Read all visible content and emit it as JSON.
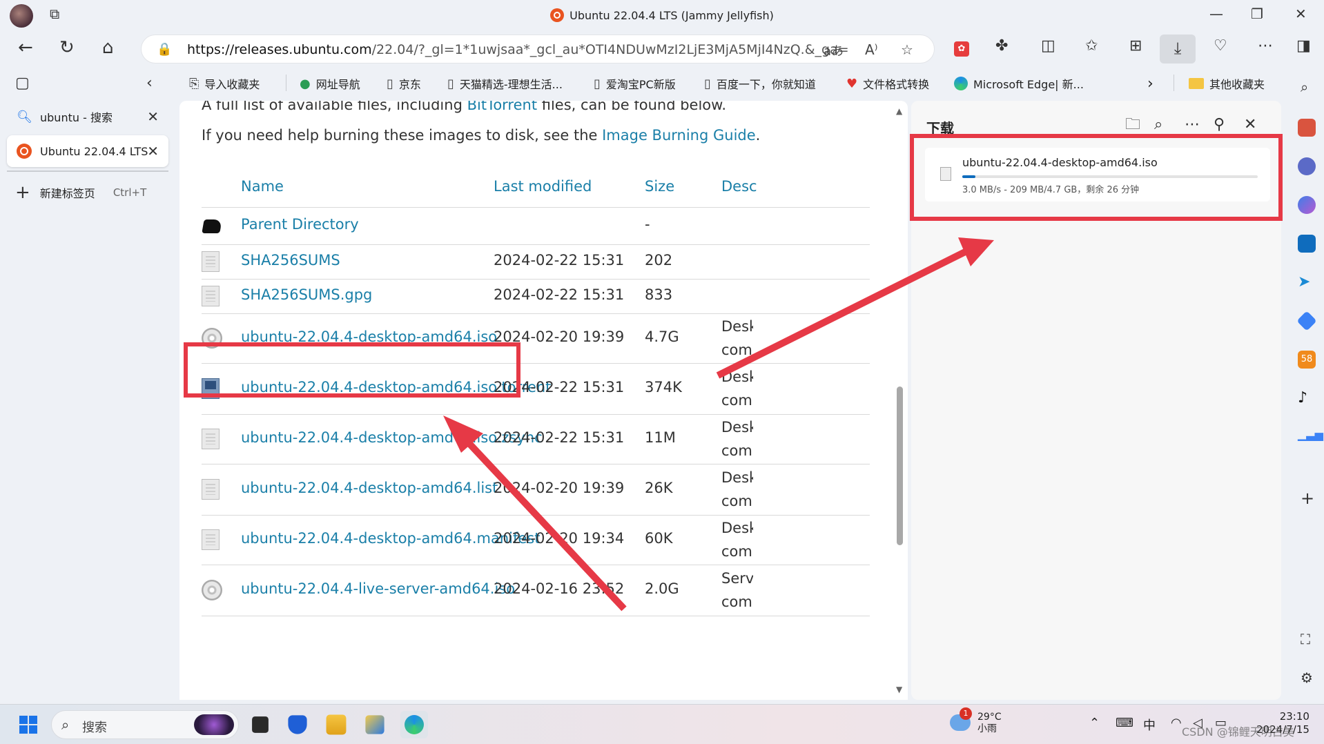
{
  "window": {
    "title": "Ubuntu 22.04.4 LTS (Jammy Jellyfish)"
  },
  "address_bar": {
    "url_host": "https://releases.ubuntu.com",
    "url_rest": "/22.04/?_gl=1*1uwjsaa*_gcl_au*OTI4NDUwMzI2LjE3MjA5MjI4NzQ.&_ga=2....",
    "read_aloud_icon": "aあ"
  },
  "favorites": [
    {
      "label": "导入收藏夹",
      "icon": "import-icon"
    },
    {
      "label": "网址导航",
      "icon": "globe-icon"
    },
    {
      "label": "京东",
      "icon": "page-icon"
    },
    {
      "label": "天猫精选-理想生活...",
      "icon": "page-icon"
    },
    {
      "label": "爱淘宝PC新版",
      "icon": "page-icon"
    },
    {
      "label": "百度一下，你就知道",
      "icon": "page-icon"
    },
    {
      "label": "文件格式转换",
      "icon": "heart-icon"
    },
    {
      "label": "Microsoft Edge| 新...",
      "icon": "edge-icon"
    }
  ],
  "other_favorites": "其他收藏夹",
  "tabs": [
    {
      "label": "ubuntu - 搜索",
      "active": false
    },
    {
      "label": "Ubuntu 22.04.4 LTS",
      "active": true
    }
  ],
  "new_tab": {
    "label": "新建标签页",
    "shortcut": "Ctrl+T"
  },
  "page": {
    "intro_prefix": "A full list of available files, including ",
    "intro_link": "BitTorrent",
    "intro_suffix": " files, can be found below.",
    "burn_prefix": "If you need help burning these images to disk, see the ",
    "burn_link": "Image Burning Guide",
    "burn_suffix": ".",
    "headers": {
      "name": "Name",
      "modified": "Last modified",
      "size": "Size",
      "desc": "Desc"
    },
    "rows": [
      {
        "name": "Parent Directory",
        "modified": "",
        "size": "-",
        "desc1": "",
        "desc2": "",
        "icon": "parent"
      },
      {
        "name": "SHA256SUMS",
        "modified": "2024-02-22 15:31",
        "size": "202",
        "desc1": "",
        "desc2": "",
        "icon": "file"
      },
      {
        "name": "SHA256SUMS.gpg",
        "modified": "2024-02-22 15:31",
        "size": "833",
        "desc1": "",
        "desc2": "",
        "icon": "file"
      },
      {
        "name": "ubuntu-22.04.4-desktop-amd64.iso",
        "modified": "2024-02-20 19:39",
        "size": "4.7G",
        "desc1": "Desk",
        "desc2": "com",
        "icon": "disc"
      },
      {
        "name": "ubuntu-22.04.4-desktop-amd64.iso.torrent",
        "modified": "2024-02-22 15:31",
        "size": "374K",
        "desc1": "Desk",
        "desc2": "com",
        "icon": "torrent"
      },
      {
        "name": "ubuntu-22.04.4-desktop-amd64.iso.zsync",
        "modified": "2024-02-22 15:31",
        "size": "11M",
        "desc1": "Desk",
        "desc2": "com",
        "icon": "file"
      },
      {
        "name": "ubuntu-22.04.4-desktop-amd64.list",
        "modified": "2024-02-20 19:39",
        "size": "26K",
        "desc1": "Desk",
        "desc2": "com",
        "icon": "file"
      },
      {
        "name": "ubuntu-22.04.4-desktop-amd64.manifest",
        "modified": "2024-02-20 19:34",
        "size": "60K",
        "desc1": "Desk",
        "desc2": "com",
        "icon": "file"
      },
      {
        "name": "ubuntu-22.04.4-live-server-amd64.iso",
        "modified": "2024-02-16 23:52",
        "size": "2.0G",
        "desc1": "Serv",
        "desc2": "com",
        "icon": "disc"
      }
    ]
  },
  "downloads": {
    "title": "下载",
    "item": {
      "filename": "ubuntu-22.04.4-desktop-amd64.iso",
      "status": "3.0 MB/s - 209 MB/4.7 GB，剩余 26 分钟",
      "progress": 0.044
    }
  },
  "taskbar": {
    "search_label": "搜索",
    "weather_temp": "29°C",
    "weather_desc": "小雨",
    "weather_badge": "1",
    "ime": "中",
    "time": "23:10",
    "date": "2024/7/15"
  },
  "watermark": "CSDN @锦鲤天明古美"
}
